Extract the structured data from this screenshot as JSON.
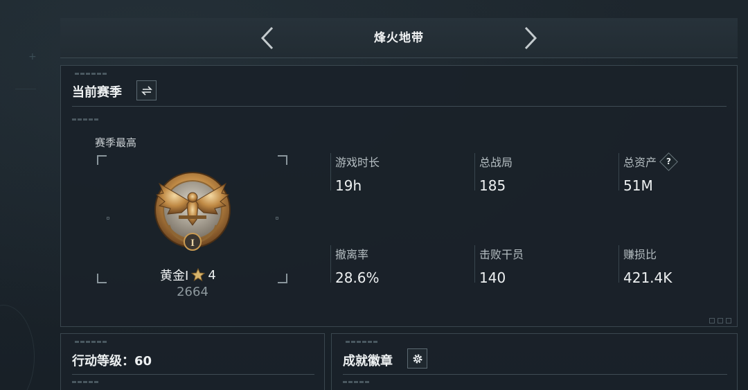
{
  "header": {
    "title": "烽火地带"
  },
  "current_season": {
    "title": "当前赛季",
    "rank": {
      "caption": "赛季最高",
      "name": "黄金I",
      "stars": "4",
      "score": "2664"
    },
    "stats": [
      {
        "label": "游戏时长",
        "value": "19h"
      },
      {
        "label": "总战局",
        "value": "185"
      },
      {
        "label": "总资产",
        "value": "51M",
        "help": "?"
      },
      {
        "label": "撤离率",
        "value": "28.6%"
      },
      {
        "label": "击败干员",
        "value": "140"
      },
      {
        "label": "赚损比",
        "value": "421.4K"
      }
    ]
  },
  "level_panel": {
    "title": "行动等级：60"
  },
  "badge_panel": {
    "title": "成就徽章"
  },
  "colors": {
    "background": "#1a2229",
    "panel_border": "#3a474f",
    "gold": "#c89a52",
    "text": "#eef1f2"
  },
  "icons": [
    "chevron-left-icon",
    "chevron-right-icon",
    "swap-icon",
    "medal-icon",
    "star-icon",
    "help-icon",
    "gear-icon"
  ]
}
